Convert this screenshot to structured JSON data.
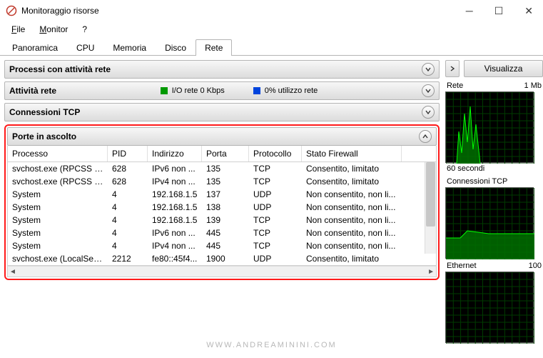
{
  "window": {
    "title": "Monitoraggio risorse"
  },
  "menu": {
    "file": "File",
    "monitor": "Monitor",
    "help": "?"
  },
  "tabs": [
    {
      "label": "Panoramica"
    },
    {
      "label": "CPU"
    },
    {
      "label": "Memoria"
    },
    {
      "label": "Disco"
    },
    {
      "label": "Rete",
      "active": true
    }
  ],
  "sections": {
    "net_processes": {
      "title": "Processi con attività rete"
    },
    "net_activity": {
      "title": "Attività rete",
      "io_color": "#009900",
      "io_label": "I/O rete 0 Kbps",
      "util_color": "#0044dd",
      "util_label": "0% utilizzo rete"
    },
    "tcp": {
      "title": "Connessioni TCP"
    },
    "ports": {
      "title": "Porte in ascolto"
    }
  },
  "columns": [
    "Processo",
    "PID",
    "Indirizzo",
    "Porta",
    "Protocollo",
    "Stato Firewall"
  ],
  "rows": [
    {
      "proc": "svchost.exe (RPCSS -p)",
      "pid": "628",
      "addr": "IPv6 non ...",
      "port": "135",
      "proto": "TCP",
      "fw": "Consentito, limitato"
    },
    {
      "proc": "svchost.exe (RPCSS -p)",
      "pid": "628",
      "addr": "IPv4 non ...",
      "port": "135",
      "proto": "TCP",
      "fw": "Consentito, limitato"
    },
    {
      "proc": "System",
      "pid": "4",
      "addr": "192.168.1.5",
      "port": "137",
      "proto": "UDP",
      "fw": "Non consentito, non li..."
    },
    {
      "proc": "System",
      "pid": "4",
      "addr": "192.168.1.5",
      "port": "138",
      "proto": "UDP",
      "fw": "Non consentito, non li..."
    },
    {
      "proc": "System",
      "pid": "4",
      "addr": "192.168.1.5",
      "port": "139",
      "proto": "TCP",
      "fw": "Non consentito, non li..."
    },
    {
      "proc": "System",
      "pid": "4",
      "addr": "IPv6 non ...",
      "port": "445",
      "proto": "TCP",
      "fw": "Non consentito, non li..."
    },
    {
      "proc": "System",
      "pid": "4",
      "addr": "IPv4 non ...",
      "port": "445",
      "proto": "TCP",
      "fw": "Non consentito, non li..."
    },
    {
      "proc": "svchost.exe (LocalServic...",
      "pid": "2212",
      "addr": "fe80::45f4...",
      "port": "1900",
      "proto": "UDP",
      "fw": "Consentito, limitato"
    }
  ],
  "side": {
    "button": "Visualizza",
    "graphs": [
      {
        "title": "Rete",
        "right": "1 Mb",
        "sub": "60 secondi",
        "type": "spike"
      },
      {
        "title": "Connessioni TCP",
        "right": "",
        "sub": "",
        "type": "plateau"
      },
      {
        "title": "Ethernet",
        "right": "100",
        "sub": "",
        "type": "flat"
      }
    ]
  },
  "watermark": "WWW.ANDREAMININI.COM"
}
